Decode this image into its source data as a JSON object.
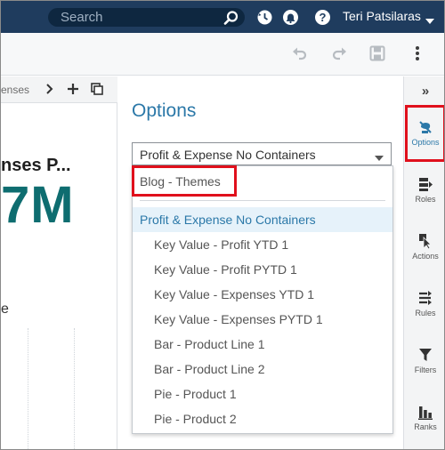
{
  "header": {
    "search_placeholder": "Search",
    "user_name": "Teri Patsilaras",
    "icons": [
      "search-icon",
      "history-icon",
      "notification-bell-icon",
      "help-icon",
      "chevron-down-icon"
    ]
  },
  "toolbar": {
    "icons": [
      "undo-icon",
      "redo-icon",
      "save-icon",
      "more-vertical-icon"
    ]
  },
  "canvas": {
    "tab_label": "enses",
    "tab_icons": [
      "chevron-right-icon",
      "add-icon",
      "copy-icon"
    ],
    "kpi_title": "nses P...",
    "kpi_value": "7M",
    "kpi_sub": "e"
  },
  "options": {
    "title": "Options",
    "selected_value": "Profit & Expense No Containers",
    "dropdown": {
      "items": [
        {
          "label": "Blog - Themes",
          "level": "top"
        },
        {
          "label": "Profit & Expense No Containers",
          "level": "top",
          "selected": true
        },
        {
          "label": "Key Value - Profit YTD 1",
          "level": "sub"
        },
        {
          "label": "Key Value - Profit PYTD 1",
          "level": "sub"
        },
        {
          "label": "Key Value - Expenses YTD 1",
          "level": "sub"
        },
        {
          "label": "Key Value - Expenses PYTD 1",
          "level": "sub"
        },
        {
          "label": "Bar - Product Line 1",
          "level": "sub"
        },
        {
          "label": "Bar - Product Line 2",
          "level": "sub"
        },
        {
          "label": "Pie - Product 1",
          "level": "sub"
        },
        {
          "label": "Pie - Product 2",
          "level": "sub"
        }
      ]
    }
  },
  "rail": {
    "collapse_glyph": "»",
    "items": [
      {
        "label": "Options",
        "icon": "options-brush-icon",
        "active": true
      },
      {
        "label": "Roles",
        "icon": "roles-icon"
      },
      {
        "label": "Actions",
        "icon": "actions-cursor-icon"
      },
      {
        "label": "Rules",
        "icon": "rules-icon"
      },
      {
        "label": "Filters",
        "icon": "filter-funnel-icon"
      },
      {
        "label": "Ranks",
        "icon": "ranks-bars-icon"
      }
    ]
  },
  "colors": {
    "banner": "#1f3c5e",
    "accent": "#2b78a8",
    "kpi": "#0e6d70",
    "highlight": "#e0101c",
    "selected_bg": "#e6f2fa"
  }
}
